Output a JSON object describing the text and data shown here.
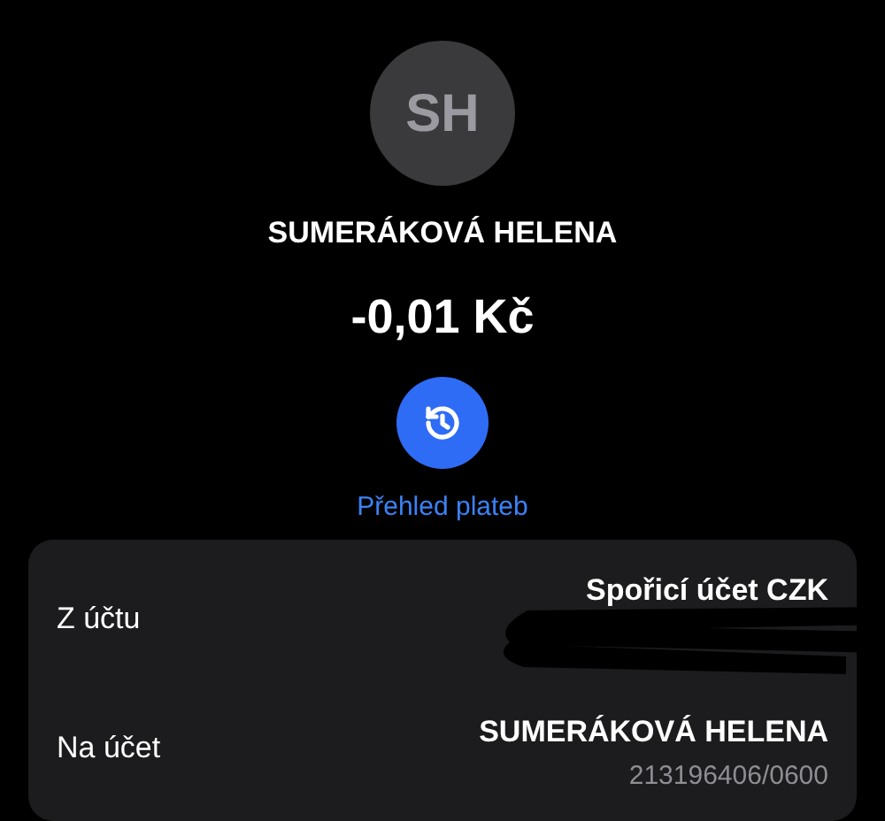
{
  "header": {
    "avatar_initials": "SH",
    "name": "SUMERÁKOVÁ HELENA",
    "amount": "-0,01 Kč",
    "history_link": "Přehled plateb"
  },
  "details": [
    {
      "label": "Z účtu",
      "value": "Spořicí účet CZK",
      "redacted": true
    },
    {
      "label": "Na účet",
      "value": "SUMERÁKOVÁ HELENA",
      "sub_value": "213196406/0600",
      "redacted": false
    }
  ]
}
